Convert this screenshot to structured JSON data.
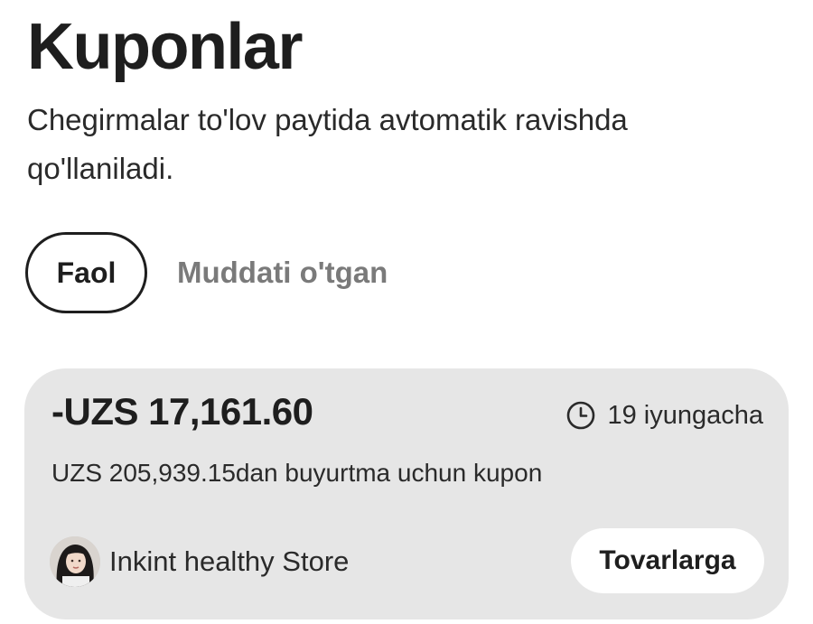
{
  "page": {
    "title": "Kuponlar",
    "subtitle": "Chegirmalar to'lov paytida avtomatik ravishda qo'llaniladi."
  },
  "tabs": {
    "active": "Faol",
    "inactive": "Muddati o'tgan"
  },
  "coupon": {
    "amount": "-UZS 17,161.60",
    "expiry": "19 iyungacha",
    "condition": "UZS 205,939.15dan buyurtma uchun kupon",
    "store_name": "Inkint healthy Store",
    "button_label": "Tovarlarga",
    "card_color": "#e6e6e6"
  },
  "icons": {
    "expiry": "clock-icon",
    "store": "store-avatar"
  }
}
